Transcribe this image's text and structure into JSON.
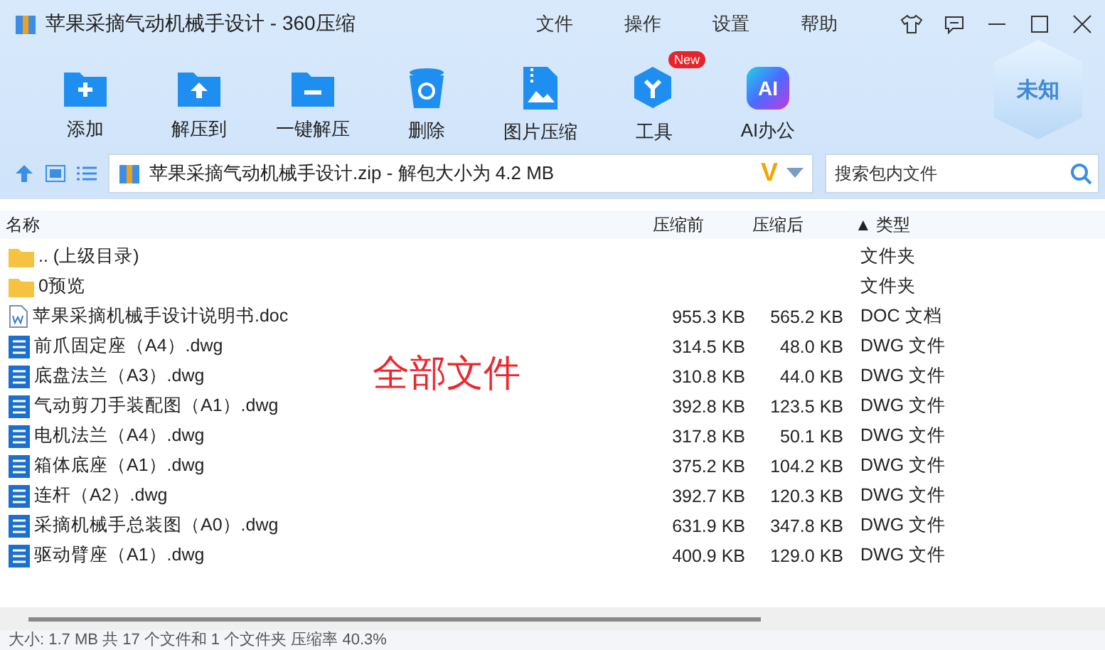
{
  "window": {
    "title": "苹果采摘气动机械手设计 - 360压缩"
  },
  "menu": [
    "文件",
    "操作",
    "设置",
    "帮助"
  ],
  "toolbar": [
    {
      "kind": "add",
      "label": "添加"
    },
    {
      "kind": "extract",
      "label": "解压到"
    },
    {
      "kind": "oneclick",
      "label": "一键解压"
    },
    {
      "kind": "delete",
      "label": "删除"
    },
    {
      "kind": "image",
      "label": "图片压缩"
    },
    {
      "kind": "tools",
      "label": "工具",
      "badge": "New"
    },
    {
      "kind": "ai",
      "label": "AI办公",
      "icon_text": "AI"
    }
  ],
  "shield": "未知",
  "address": {
    "path": "苹果采摘气动机械手设计.zip - 解包大小为 4.2 MB",
    "v_mark": "V"
  },
  "search": {
    "placeholder": "搜索包内文件"
  },
  "columns": [
    "名称",
    "压缩前",
    "压缩后",
    "▲ 类型"
  ],
  "rows": [
    {
      "kind": "folder",
      "name": ".. (上级目录)",
      "size": "",
      "packed": "",
      "type": "文件夹"
    },
    {
      "kind": "folder",
      "name": "0预览",
      "size": "",
      "packed": "",
      "type": "文件夹"
    },
    {
      "kind": "doc",
      "name": "苹果采摘机械手设计说明书.doc",
      "size": "955.3 KB",
      "packed": "565.2 KB",
      "type": "DOC 文档"
    },
    {
      "kind": "dwg",
      "name": "前爪固定座（A4）.dwg",
      "size": "314.5 KB",
      "packed": "48.0 KB",
      "type": "DWG 文件"
    },
    {
      "kind": "dwg",
      "name": "底盘法兰（A3）.dwg",
      "size": "310.8 KB",
      "packed": "44.0 KB",
      "type": "DWG 文件"
    },
    {
      "kind": "dwg",
      "name": "气动剪刀手装配图（A1）.dwg",
      "size": "392.8 KB",
      "packed": "123.5 KB",
      "type": "DWG 文件"
    },
    {
      "kind": "dwg",
      "name": "电机法兰（A4）.dwg",
      "size": "317.8 KB",
      "packed": "50.1 KB",
      "type": "DWG 文件"
    },
    {
      "kind": "dwg",
      "name": "箱体底座（A1）.dwg",
      "size": "375.2 KB",
      "packed": "104.2 KB",
      "type": "DWG 文件"
    },
    {
      "kind": "dwg",
      "name": "连杆（A2）.dwg",
      "size": "392.7 KB",
      "packed": "120.3 KB",
      "type": "DWG 文件"
    },
    {
      "kind": "dwg",
      "name": "采摘机械手总装图（A0）.dwg",
      "size": "631.9 KB",
      "packed": "347.8 KB",
      "type": "DWG 文件"
    },
    {
      "kind": "dwg",
      "name": "驱动臂座（A1）.dwg",
      "size": "400.9 KB",
      "packed": "129.0 KB",
      "type": "DWG 文件"
    }
  ],
  "overlay_label": "全部文件",
  "status_bar": "大小: 1.7 MB 共 17 个文件和 1 个文件夹 压缩率 40.3%"
}
